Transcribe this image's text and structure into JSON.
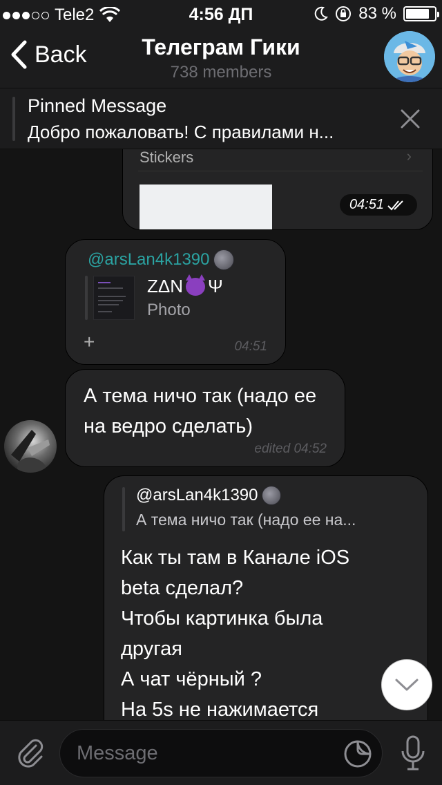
{
  "status_bar": {
    "carrier": "Tele2",
    "time": "4:56 ДП",
    "battery_percent_text": "83 %",
    "battery_level": 0.83,
    "signal_filled": 3,
    "signal_total": 5
  },
  "nav": {
    "back_label": "Back",
    "title": "Телеграм Гики",
    "subtitle": "738 members"
  },
  "pinned": {
    "title": "Pinned Message",
    "text": "Добро пожаловать! С правилами н..."
  },
  "messages": {
    "top_outgoing": {
      "stickers_label": "Stickers",
      "time": "04:51"
    },
    "photo_message": {
      "author": "@arsLan4k1390",
      "forward_name": "ZΔN",
      "forward_suffix": "Ψ",
      "forward_type": "Photo",
      "plus": "+",
      "time": "04:51"
    },
    "text_message": {
      "text": "А тема ничо так (надо ее на ведро сделать)",
      "time": "edited 04:52"
    },
    "reply_message": {
      "reply_author": "@arsLan4k1390",
      "reply_text": "А тема ничо так (надо ее на...",
      "lines": [
        "Как ты там в Канале iOS",
        "beta сделал?",
        "Чтобы картинка была",
        "другая",
        "А чат чёрный ?",
        "На 5s не нажимается"
      ]
    }
  },
  "input": {
    "placeholder": "Message"
  },
  "colors": {
    "accent_author": "#2ba3a2",
    "bubble": "#242425",
    "background": "#141414",
    "bar": "#1c1c1d"
  }
}
